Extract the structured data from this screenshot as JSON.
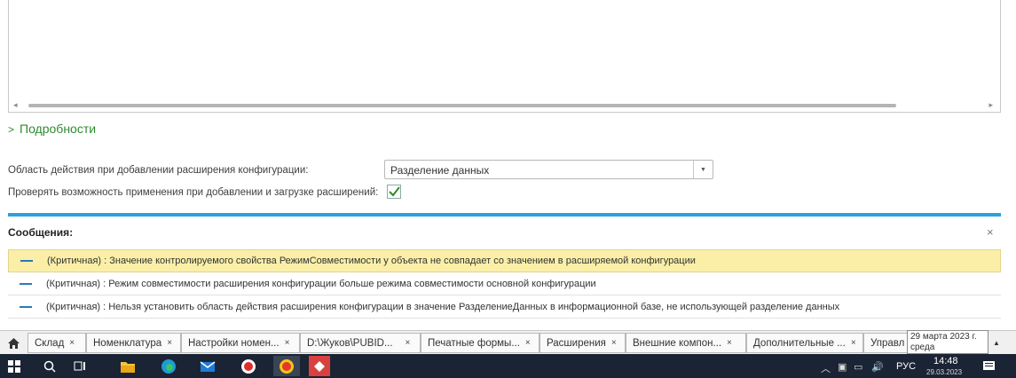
{
  "details": {
    "label": "Подробности"
  },
  "settings": {
    "scope_label": "Область действия при добавлении расширения конфигурации:",
    "scope_value": "Разделение данных",
    "check_label": "Проверять возможность применения при добавлении и загрузке расширений:",
    "check_checked": true
  },
  "messages": {
    "title": "Сообщения:",
    "close": "×",
    "items": [
      {
        "text": "(Критичная) : Значение контролируемого свойства РежимСовместимости у объекта  не совпадает со значением в расширяемой конфигурации",
        "selected": true
      },
      {
        "text": "(Критичная) : Режим совместимости расширения конфигурации больше режима совместимости основной конфигурации",
        "selected": false
      },
      {
        "text": "(Критичная) : Нельзя установить область действия расширения конфигурации в значение РазделениеДанных в информационной базе, не использующей разделение данных",
        "selected": false
      }
    ]
  },
  "tabs": [
    {
      "label": "Склад"
    },
    {
      "label": "Номенклатура"
    },
    {
      "label": "Настройки номен..."
    },
    {
      "label": "D:\\Жуков\\PUBID..."
    },
    {
      "label": "Печатные формы..."
    },
    {
      "label": "Расширения"
    },
    {
      "label": "Внешние компон..."
    },
    {
      "label": "Дополнительные ..."
    },
    {
      "label": "Управл"
    }
  ],
  "tab_close": "×",
  "tooltip": {
    "date": "29 марта 2023 г.",
    "weekday": "среда"
  },
  "taskbar": {
    "language": "РУС",
    "time": "14:48",
    "date_partial": "29.03.2023"
  },
  "colors": {
    "accent_blue": "#2aa3db",
    "details_green": "#2e8b2e",
    "selected_row": "#fbefa8",
    "taskbar": "#1b2434"
  }
}
